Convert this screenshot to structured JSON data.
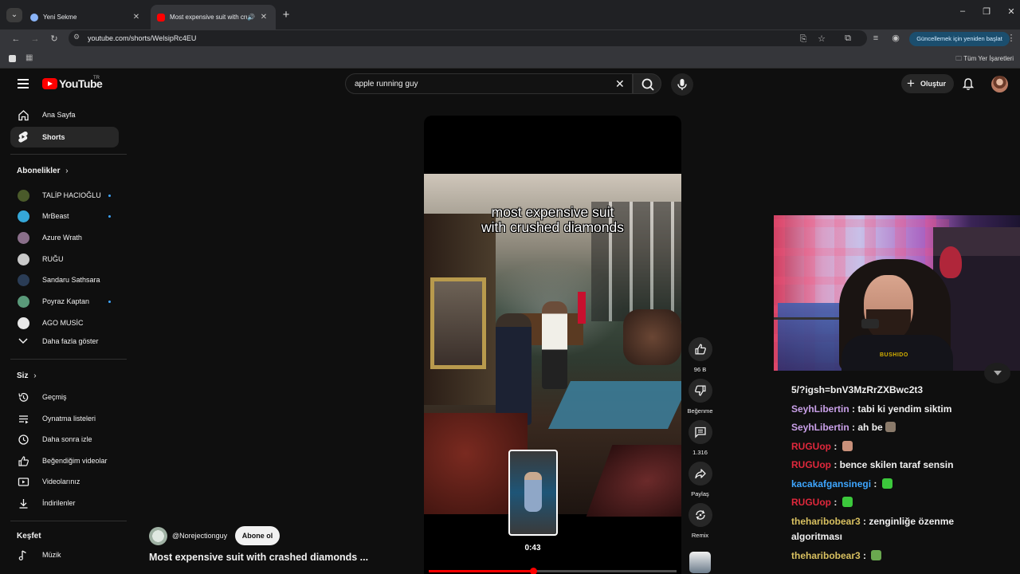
{
  "browser": {
    "tabs": [
      {
        "title": "Yeni Sekme",
        "active": false
      },
      {
        "title": "Most expensive suit with crushed diamonds",
        "active": true
      }
    ],
    "url": "youtube.com/shorts/WelsipRc4EU",
    "update_button": "Güncellemek için yeniden başlat",
    "bookmarks_all": "Tüm Yer İşaretleri"
  },
  "header": {
    "logo": "YouTube",
    "region": "TR",
    "search_value": "apple running guy",
    "create_label": "Oluştur"
  },
  "sidebar": {
    "main": [
      {
        "label": "Ana Sayfa",
        "icon": "home-icon"
      },
      {
        "label": "Shorts",
        "icon": "shorts-icon",
        "active": true
      }
    ],
    "subscriptions_heading": "Abonelikler",
    "subscriptions": [
      {
        "label": "TALİP HACIOĞLU",
        "color": "#4a5a2a",
        "new": true
      },
      {
        "label": "MrBeast",
        "color": "#35a7d8",
        "new": true
      },
      {
        "label": "Azure Wrath",
        "color": "#8a6f8a",
        "new": false
      },
      {
        "label": "RUĞU",
        "color": "#c9c9c9",
        "new": false
      },
      {
        "label": "Sandaru Sathsara",
        "color": "#2a3c55",
        "new": false
      },
      {
        "label": "Poyraz Kaptan",
        "color": "#5a9a7a",
        "new": true
      },
      {
        "label": "AGO MUSİC",
        "color": "#e8e8e8",
        "new": false
      }
    ],
    "show_more": "Daha fazla göster",
    "you_heading": "Siz",
    "you_items": [
      {
        "label": "Geçmiş",
        "icon": "history-icon"
      },
      {
        "label": "Oynatma listeleri",
        "icon": "playlists-icon"
      },
      {
        "label": "Daha sonra izle",
        "icon": "watch-later-icon"
      },
      {
        "label": "Beğendiğim videolar",
        "icon": "liked-icon"
      },
      {
        "label": "Videolarınız",
        "icon": "your-videos-icon"
      },
      {
        "label": "İndirilenler",
        "icon": "downloads-icon"
      }
    ],
    "explore_heading": "Keşfet",
    "explore_items": [
      {
        "label": "Müzik",
        "icon": "music-icon"
      }
    ]
  },
  "short": {
    "caption_line1": "most expensive suit",
    "caption_line2": "with crushed diamonds",
    "seek_time": "0:43",
    "progress": 0.42,
    "channel": "@Norejectionguy",
    "subscribe_label": "Abone ol",
    "title": "Most expensive suit with crashed diamonds ...",
    "actions": {
      "like_count": "96 B",
      "dislike_label": "Beğenme",
      "comment_count": "1.316",
      "share_label": "Paylaş",
      "remix_label": "Remix"
    }
  },
  "stream_overlay": {
    "webcam_logo": "BUSHIDO",
    "chat": [
      {
        "user": "",
        "text": "5/?igsh=bnV3MzRrZXBwc2t3",
        "user_color": "#f1f1f1"
      },
      {
        "user": "SeyhLibertin",
        "text": "tabi ki yendim siktim",
        "user_color": "#c9a0e8"
      },
      {
        "user": "SeyhLibertin",
        "text": "ah be",
        "user_color": "#c9a0e8",
        "emote_color": "#8a7a6a"
      },
      {
        "user": "RUGUop",
        "text": "",
        "user_color": "#e0283c",
        "emote_color": "#c8907a"
      },
      {
        "user": "RUGUop",
        "text": "bence skilen taraf sensin",
        "user_color": "#e0283c"
      },
      {
        "user": "kacakafgansinegi",
        "text": "",
        "user_color": "#3ea6ff",
        "emote_color": "#3cc83c"
      },
      {
        "user": "RUGUop",
        "text": "",
        "user_color": "#e0283c",
        "emote_color": "#3cc83c"
      },
      {
        "user": "theharibobear3",
        "text": "zenginliğe özenme",
        "user_color": "#d8c060"
      },
      {
        "user": "",
        "text": "algoritması",
        "user_color": "#f1f1f1"
      },
      {
        "user": "theharibobear3",
        "text": "",
        "user_color": "#d8c060",
        "emote_color": "#6aa84f"
      }
    ]
  },
  "colors": {
    "accent_red": "#ff0000",
    "background": "#0f0f0f",
    "surface": "#272727"
  }
}
